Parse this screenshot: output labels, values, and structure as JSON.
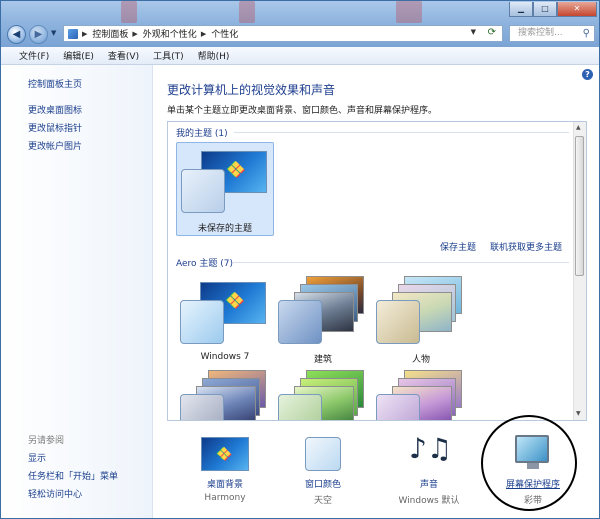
{
  "address": {
    "crumbs": [
      "控制面板",
      "外观和个性化",
      "个性化"
    ]
  },
  "search": {
    "placeholder": "搜索控制..."
  },
  "menubar": [
    {
      "label": "文件(F)"
    },
    {
      "label": "编辑(E)"
    },
    {
      "label": "查看(V)"
    },
    {
      "label": "工具(T)"
    },
    {
      "label": "帮助(H)"
    }
  ],
  "sidebar": {
    "links": [
      "控制面板主页",
      "更改桌面图标",
      "更改鼠标指针",
      "更改帐户图片"
    ],
    "see_also_heading": "另请参阅",
    "see_also": [
      "显示",
      "任务栏和「开始」菜单",
      "轻松访问中心"
    ]
  },
  "main": {
    "title": "更改计算机上的视觉效果和声音",
    "subtitle": "单击某个主题立即更改桌面背景、窗口颜色、声音和屏幕保护程序。",
    "my_themes": {
      "heading": "我的主题 (1)",
      "items": [
        {
          "label": "未保存的主题"
        }
      ],
      "save_link": "保存主题",
      "online_link": "联机获取更多主题"
    },
    "aero_themes": {
      "heading": "Aero 主题 (7)",
      "items": [
        {
          "label": "Windows 7"
        },
        {
          "label": "建筑"
        },
        {
          "label": "人物"
        }
      ]
    }
  },
  "tools": [
    {
      "name": "桌面背景",
      "value": "Harmony"
    },
    {
      "name": "窗口颜色",
      "value": "天空"
    },
    {
      "name": "声音",
      "value": "Windows 默认"
    },
    {
      "name": "屏幕保护程序",
      "value": "彩带"
    }
  ],
  "colors": {
    "link": "#1a3e8c",
    "title_bar": "#8fb4de",
    "selection": "#d7e7fb"
  }
}
